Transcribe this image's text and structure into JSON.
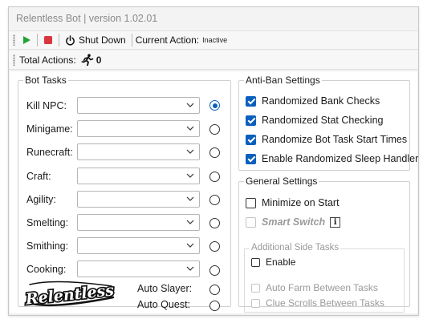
{
  "window": {
    "title": "Relentless Bot | version 1.02.01"
  },
  "toolbar": {
    "shutdown_label": "Shut Down",
    "current_action_label": "Current Action:",
    "current_action_value": "Inactive"
  },
  "status": {
    "total_actions_label": "Total Actions:",
    "total_actions_value": "0"
  },
  "bot_tasks": {
    "title": "Bot Tasks",
    "tasks": [
      {
        "label": "Kill NPC:",
        "value": "",
        "selected": true
      },
      {
        "label": "Minigame:",
        "value": "",
        "selected": false
      },
      {
        "label": "Runecraft:",
        "value": "",
        "selected": false
      },
      {
        "label": "Craft:",
        "value": "",
        "selected": false
      },
      {
        "label": "Agility:",
        "value": "",
        "selected": false
      },
      {
        "label": "Smelting:",
        "value": "",
        "selected": false
      },
      {
        "label": "Smithing:",
        "value": "",
        "selected": false
      },
      {
        "label": "Cooking:",
        "value": "",
        "selected": false
      }
    ],
    "auto_slayer_label": "Auto Slayer:",
    "auto_quest_label": "Auto Quest:",
    "logo_text": "Relentless"
  },
  "anti_ban": {
    "title": "Anti-Ban Settings",
    "options": [
      {
        "label": "Randomized Bank Checks",
        "checked": true
      },
      {
        "label": "Randomized Stat Checking",
        "checked": true
      },
      {
        "label": "Randomize Bot Task Start Times",
        "checked": true
      },
      {
        "label": "Enable Randomized Sleep Handler",
        "checked": true
      }
    ]
  },
  "general": {
    "title": "General Settings",
    "minimize_label": "Minimize on Start",
    "smart_switch_label": "Smart Switch",
    "info_glyph": "i",
    "additional": {
      "title": "Additional Side Tasks",
      "enable_label": "Enable",
      "auto_farm_label": "Auto Farm Between Tasks",
      "clue_scrolls_label": "Clue Scrolls Between Tasks"
    }
  },
  "colors": {
    "accent": "#0a5fbd",
    "play": "#22a33a",
    "stop": "#d9363e",
    "disabled_text": "#9a9a9a"
  },
  "icons": [
    "play-icon",
    "stop-icon",
    "power-icon",
    "runner-icon",
    "chevron-down-icon",
    "info-icon"
  ]
}
